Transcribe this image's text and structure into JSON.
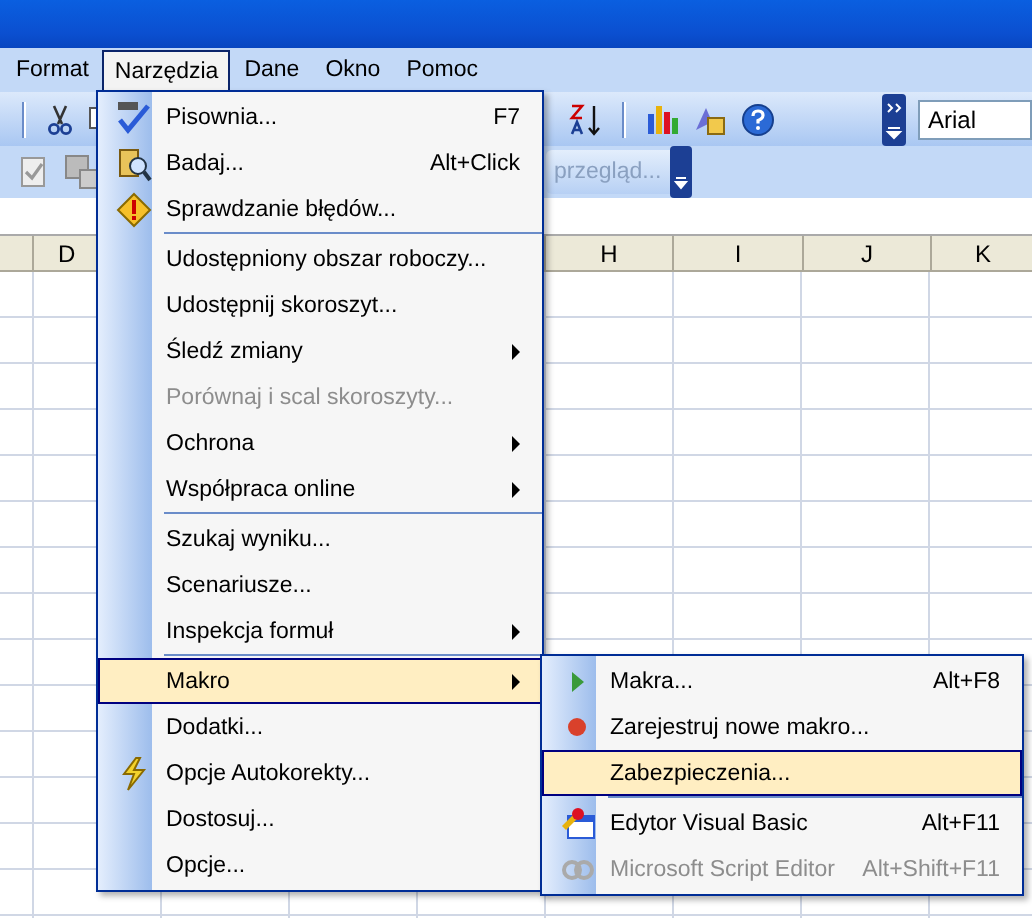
{
  "menubar": [
    {
      "label": "Format",
      "selected": false
    },
    {
      "label": "Narzędzia",
      "selected": true
    },
    {
      "label": "Dane",
      "selected": false
    },
    {
      "label": "Okno",
      "selected": false
    },
    {
      "label": "Pomoc",
      "selected": false
    }
  ],
  "toolbar": {
    "font": "Arial"
  },
  "review_toolbar": {
    "button": "przegląd..."
  },
  "columns": [
    {
      "label": "D"
    },
    {
      "label": "H"
    },
    {
      "label": "I"
    },
    {
      "label": "J"
    },
    {
      "label": "K"
    }
  ],
  "menu": [
    {
      "kind": "item",
      "label": "Pisownia...",
      "shortcut": "F7",
      "submenu": false,
      "disabled": false,
      "selected": false
    },
    {
      "kind": "item",
      "label": "Badaj...",
      "shortcut": "Alt+Click",
      "submenu": false,
      "disabled": false,
      "selected": false
    },
    {
      "kind": "item",
      "label": "Sprawdzanie błędów...",
      "submenu": false,
      "disabled": false,
      "selected": false
    },
    {
      "kind": "separator"
    },
    {
      "kind": "item",
      "label": "Udostępniony obszar roboczy...",
      "submenu": false,
      "disabled": false,
      "selected": false
    },
    {
      "kind": "item",
      "label": "Udostępnij skoroszyt...",
      "submenu": false,
      "disabled": false,
      "selected": false
    },
    {
      "kind": "item",
      "label": "Śledź zmiany",
      "submenu": true,
      "disabled": false,
      "selected": false
    },
    {
      "kind": "item",
      "label": "Porównaj i scal skoroszyty...",
      "submenu": false,
      "disabled": true,
      "selected": false
    },
    {
      "kind": "item",
      "label": "Ochrona",
      "submenu": true,
      "disabled": false,
      "selected": false
    },
    {
      "kind": "item",
      "label": "Współpraca online",
      "submenu": true,
      "disabled": false,
      "selected": false
    },
    {
      "kind": "separator"
    },
    {
      "kind": "item",
      "label": "Szukaj wyniku...",
      "submenu": false,
      "disabled": false,
      "selected": false
    },
    {
      "kind": "item",
      "label": "Scenariusze...",
      "submenu": false,
      "disabled": false,
      "selected": false
    },
    {
      "kind": "item",
      "label": "Inspekcja formuł",
      "submenu": true,
      "disabled": false,
      "selected": false
    },
    {
      "kind": "separator"
    },
    {
      "kind": "item",
      "label": "Makro",
      "submenu": true,
      "disabled": false,
      "selected": true
    },
    {
      "kind": "item",
      "label": "Dodatki...",
      "submenu": false,
      "disabled": false,
      "selected": false
    },
    {
      "kind": "item",
      "label": "Opcje Autokorekty...",
      "submenu": false,
      "disabled": false,
      "selected": false
    },
    {
      "kind": "item",
      "label": "Dostosuj...",
      "submenu": false,
      "disabled": false,
      "selected": false
    },
    {
      "kind": "item",
      "label": "Opcje...",
      "submenu": false,
      "disabled": false,
      "selected": false
    }
  ],
  "submenu": [
    {
      "kind": "item",
      "label": "Makra...",
      "shortcut": "Alt+F8",
      "disabled": false,
      "selected": false
    },
    {
      "kind": "item",
      "label": "Zarejestruj nowe makro...",
      "disabled": false,
      "selected": false
    },
    {
      "kind": "item",
      "label": "Zabezpieczenia...",
      "disabled": false,
      "selected": true
    },
    {
      "kind": "separator"
    },
    {
      "kind": "item",
      "label": "Edytor Visual Basic",
      "shortcut": "Alt+F11",
      "disabled": false,
      "selected": false
    },
    {
      "kind": "item",
      "label": "Microsoft Script Editor",
      "shortcut": "Alt+Shift+F11",
      "disabled": true,
      "selected": false
    }
  ]
}
